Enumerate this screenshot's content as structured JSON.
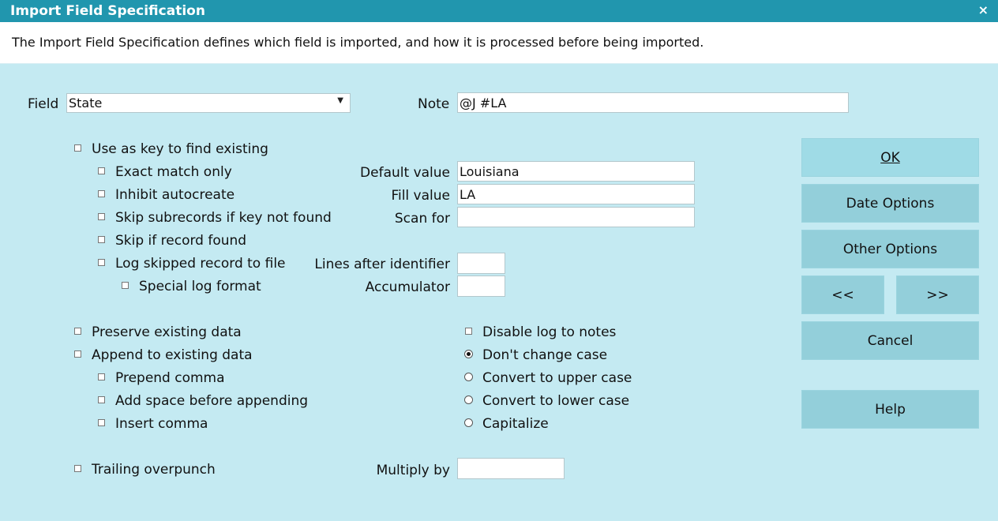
{
  "window": {
    "title": "Import Field Specification",
    "close": "×"
  },
  "description": "The Import Field Specification defines which field is imported, and how it is processed before being imported.",
  "field": {
    "label": "Field",
    "value": "State"
  },
  "note": {
    "label": "Note",
    "value": "@J #LA"
  },
  "checkboxes": {
    "use_as_key": "Use as key to find existing",
    "exact_match": "Exact match only",
    "inhibit_autocreate": "Inhibit autocreate",
    "skip_subrecords": "Skip subrecords if key not found",
    "skip_if_found": "Skip if record found",
    "log_skipped": "Log skipped record to file",
    "special_log": "Special log format",
    "preserve_existing": "Preserve existing data",
    "append_existing": "Append to existing data",
    "prepend_comma": "Prepend comma",
    "add_space": "Add space before appending",
    "insert_comma": "Insert comma",
    "trailing_overpunch": "Trailing overpunch",
    "disable_log": "Disable log to notes"
  },
  "fields": {
    "default_value": {
      "label": "Default value",
      "value": "Louisiana"
    },
    "fill_value": {
      "label": "Fill value",
      "value": "LA"
    },
    "scan_for": {
      "label": "Scan for",
      "value": ""
    },
    "lines_after": {
      "label": "Lines after identifier",
      "value": ""
    },
    "accumulator": {
      "label": "Accumulator",
      "value": ""
    },
    "multiply_by": {
      "label": "Multiply by",
      "value": ""
    }
  },
  "case_options": [
    {
      "label": "Don't change case",
      "selected": true
    },
    {
      "label": "Convert to upper case",
      "selected": false
    },
    {
      "label": "Convert to lower case",
      "selected": false
    },
    {
      "label": "Capitalize",
      "selected": false
    }
  ],
  "buttons": {
    "ok": "OK",
    "date_options": "Date Options",
    "other_options": "Other Options",
    "prev": "<<",
    "next": ">>",
    "cancel": "Cancel",
    "help": "Help"
  },
  "colors": {
    "titlebar": "#2196ae",
    "background": "#c4eaf2",
    "button": "#9fdbe6"
  }
}
